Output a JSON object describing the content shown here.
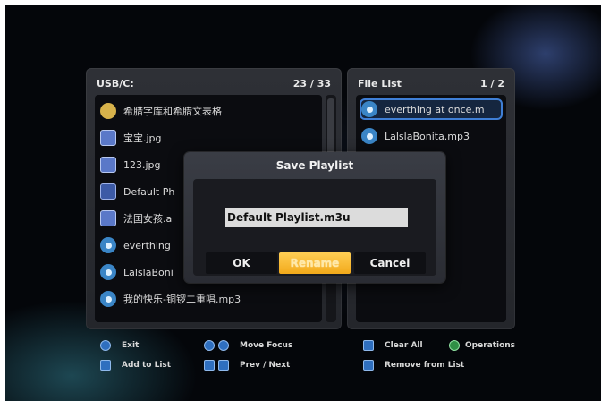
{
  "left_panel": {
    "title": "USB/C:",
    "count": "23 / 33",
    "items": [
      {
        "label": "希腊字库和希腊文表格",
        "icon": "html-document-icon"
      },
      {
        "label": "宝宝.jpg",
        "icon": "image-file-icon"
      },
      {
        "label": "123.jpg",
        "icon": "image-file-icon"
      },
      {
        "label": "Default Ph",
        "icon": "document-file-icon"
      },
      {
        "label": "法国女孩.a",
        "icon": "image-file-icon"
      },
      {
        "label": "everthing",
        "icon": "audio-file-icon"
      },
      {
        "label": "LalslaBoni",
        "icon": "audio-file-icon"
      },
      {
        "label": "我的快乐-铜锣二重唱.mp3",
        "icon": "audio-file-icon"
      }
    ]
  },
  "right_panel": {
    "title": "File List",
    "count": "1 / 2",
    "items": [
      {
        "label": "everthing at once.m",
        "icon": "audio-file-icon",
        "selected": true
      },
      {
        "label": "LalslaBonita.mp3",
        "icon": "audio-file-icon",
        "selected": false
      }
    ]
  },
  "dialog": {
    "title": "Save Playlist",
    "filename": "Default Playlist.m3u",
    "buttons": {
      "ok": "OK",
      "rename": "Rename",
      "cancel": "Cancel"
    }
  },
  "footer": {
    "exit": "Exit",
    "add_to_list": "Add to List",
    "move_focus": "Move Focus",
    "prev_next": "Prev / Next",
    "clear_all": "Clear All",
    "operations": "Operations",
    "remove_from_list": "Remove from List"
  },
  "colors": {
    "accent_yellow": "#f2a91a",
    "selection_blue": "#3f7fd6"
  }
}
